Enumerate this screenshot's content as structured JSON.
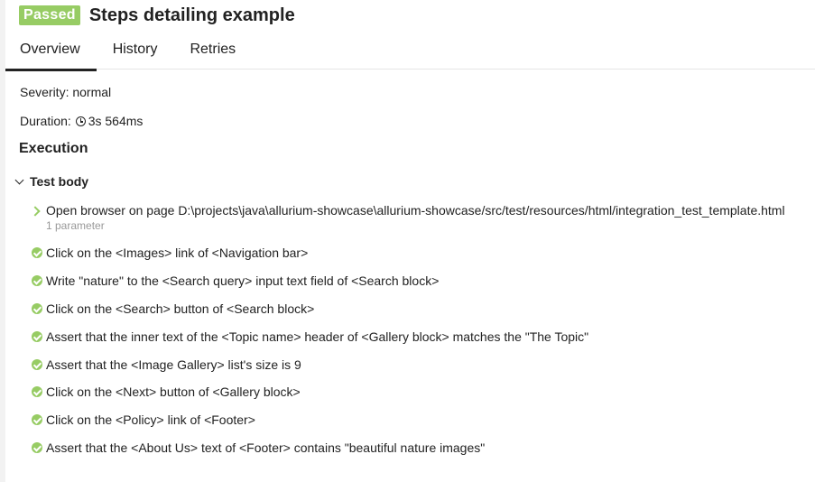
{
  "header": {
    "status": "Passed",
    "title": "Steps detailing example",
    "status_color": "#97cc64"
  },
  "tabs": [
    {
      "label": "Overview",
      "active": true
    },
    {
      "label": "History",
      "active": false
    },
    {
      "label": "Retries",
      "active": false
    }
  ],
  "info": {
    "severity": "Severity: normal",
    "duration_label": "Duration:",
    "duration_icon": "clock-icon",
    "duration_value": "3s 564ms"
  },
  "execution": {
    "title": "Execution",
    "group_title": "Test body",
    "steps": [
      {
        "text": "Open browser on page D:\\projects\\java\\allurium-showcase\\allurium-showcase/src/test/resources/html/integration_test_template.html",
        "params": "1 parameter",
        "icon": "chevron-right-icon"
      },
      {
        "text": "Click on the <Images> link of <Navigation bar>",
        "icon": "check-icon"
      },
      {
        "text": "Write \"nature\" to the <Search query> input text field of <Search block>",
        "icon": "check-icon"
      },
      {
        "text": "Click on the <Search> button of <Search block>",
        "icon": "check-icon"
      },
      {
        "text": "Assert that the inner text of the <Topic name> header of <Gallery block> matches the \"The Topic\"",
        "icon": "check-icon"
      },
      {
        "text": "Assert that the <Image Gallery> list's size is 9",
        "icon": "check-icon"
      },
      {
        "text": "Click on the <Next> button of <Gallery block>",
        "icon": "check-icon"
      },
      {
        "text": "Click on the <Policy> link of <Footer>",
        "icon": "check-icon"
      },
      {
        "text": "Assert that the <About Us> text of <Footer> contains \"beautiful nature images\"",
        "icon": "check-icon"
      }
    ]
  }
}
